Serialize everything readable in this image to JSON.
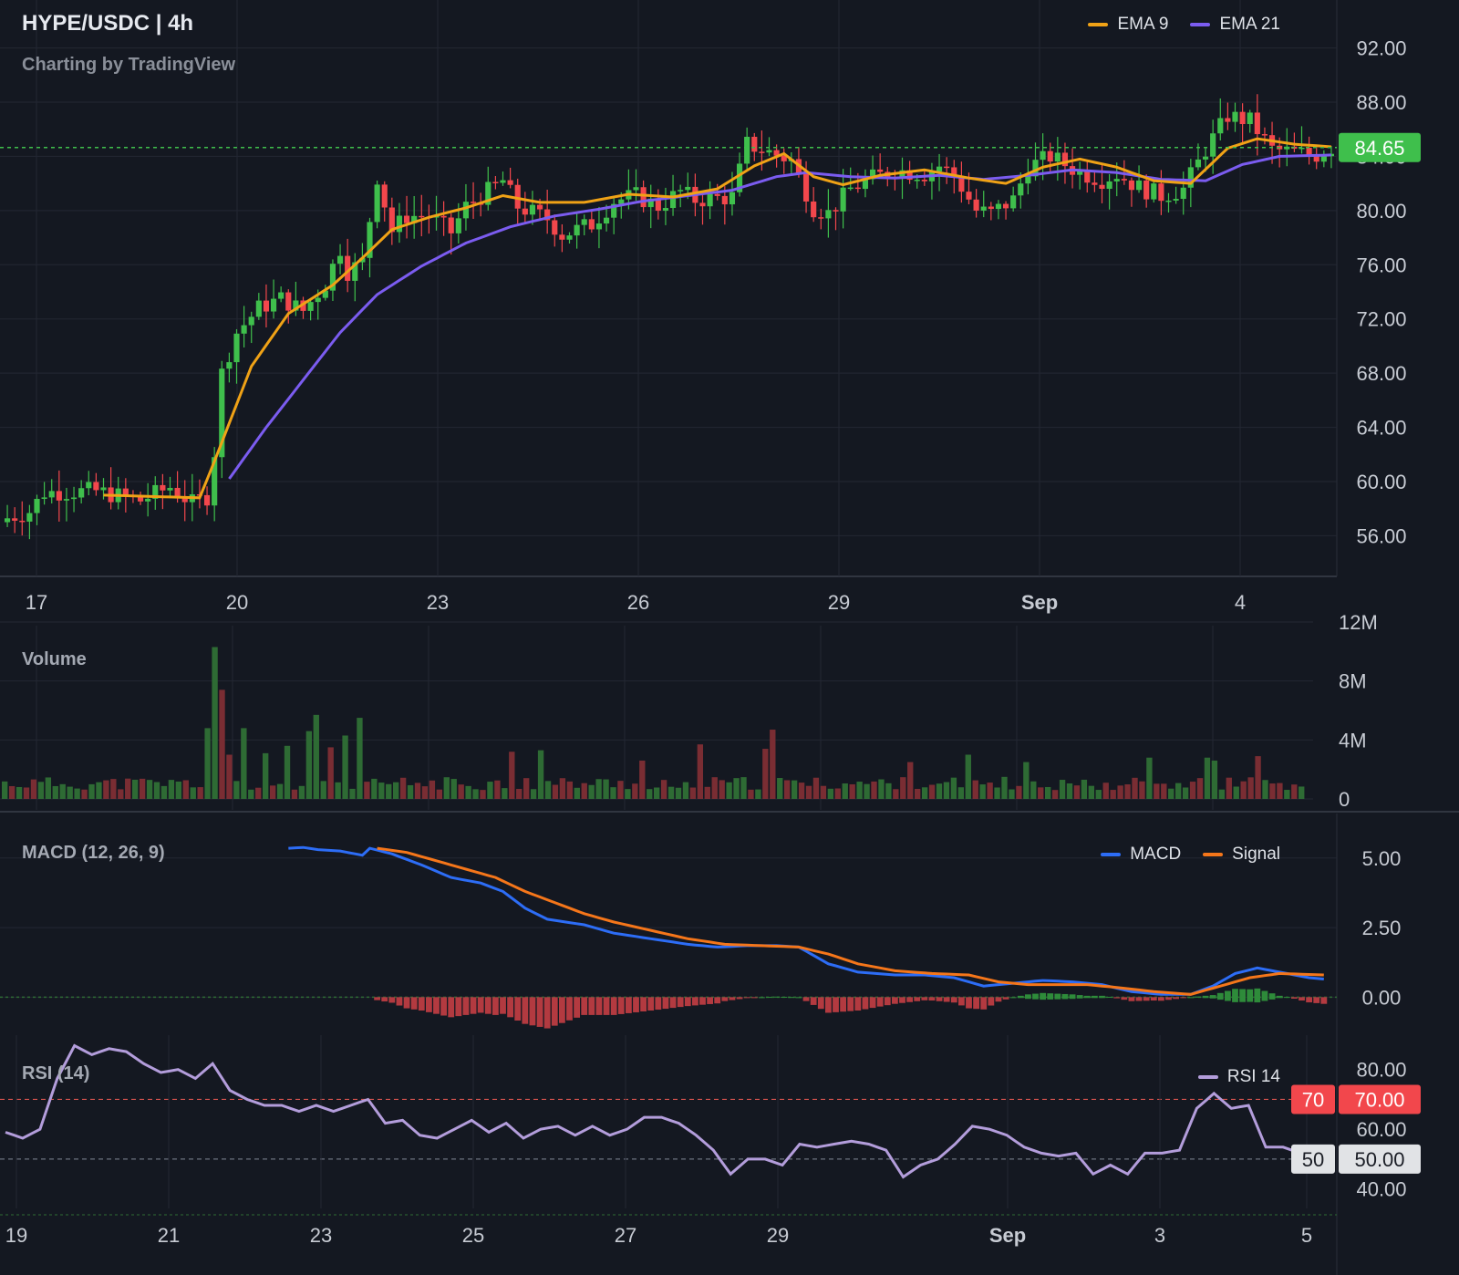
{
  "header": {
    "symbol_title": "HYPE/USDC | 4h",
    "watermark": "Charting by TradingView"
  },
  "price_pane": {
    "legend": [
      {
        "label": "EMA 9",
        "color": "#f0a216"
      },
      {
        "label": "EMA 21",
        "color": "#7b5cf0"
      }
    ],
    "last_price_label": "84.65",
    "y_ticks": [
      "92.00",
      "88.00",
      "84.00",
      "80.00",
      "76.00",
      "72.00",
      "68.00",
      "64.00",
      "60.00",
      "56.00"
    ],
    "x_ticks": [
      "17",
      "20",
      "23",
      "26",
      "29",
      "Sep",
      "4"
    ]
  },
  "volume_pane": {
    "title": "Volume",
    "y_ticks": [
      "12M",
      "8M",
      "4M",
      "0"
    ]
  },
  "macd_pane": {
    "title": "MACD (12, 26, 9)",
    "legend": [
      {
        "label": "MACD",
        "color": "#2d6df6"
      },
      {
        "label": "Signal",
        "color": "#f5761a"
      }
    ],
    "y_ticks": [
      "5.00",
      "2.50",
      "0.00"
    ]
  },
  "rsi_pane": {
    "title": "RSI (14)",
    "legend": [
      {
        "label": "RSI 14",
        "color": "#b39ddb"
      }
    ],
    "y_ticks": [
      "80.00",
      "60.00",
      "40.00"
    ],
    "badges": {
      "upper_level": "70",
      "upper_value": "70.00",
      "mid_level": "50",
      "mid_value": "50.00"
    },
    "x_ticks": [
      "19",
      "21",
      "23",
      "25",
      "27",
      "29",
      "Sep",
      "3",
      "5"
    ]
  },
  "chart_data": [
    {
      "type": "candlestick",
      "title": "HYPE/USDC | 4h",
      "ylim": [
        53,
        95
      ],
      "last_price": 84.65,
      "colors": {
        "up": "#3fbf4c",
        "down": "#f2474c"
      },
      "anchors": [
        [
          0,
          57.3
        ],
        [
          3,
          57.8
        ],
        [
          5,
          59.2
        ],
        [
          12,
          59.3
        ],
        [
          18,
          58.6
        ],
        [
          22,
          59.6
        ],
        [
          25,
          58.4
        ],
        [
          27,
          58.9
        ],
        [
          28,
          62.2
        ],
        [
          29,
          68.0
        ],
        [
          31,
          71.0
        ],
        [
          34,
          72.8
        ],
        [
          37,
          73.5
        ],
        [
          40,
          72.6
        ],
        [
          43,
          74.6
        ],
        [
          45,
          77.2
        ],
        [
          46,
          75.5
        ],
        [
          48,
          76.2
        ],
        [
          50,
          82.5
        ],
        [
          52,
          78.5
        ],
        [
          54,
          79.6
        ],
        [
          57,
          79.6
        ],
        [
          60,
          78.4
        ],
        [
          62,
          80.3
        ],
        [
          66,
          81.8
        ],
        [
          67,
          82.2
        ],
        [
          69,
          80.3
        ],
        [
          73,
          79.4
        ],
        [
          75,
          78.2
        ],
        [
          79,
          79.0
        ],
        [
          82,
          80.7
        ],
        [
          85,
          81.1
        ],
        [
          88,
          80.3
        ],
        [
          91,
          81.4
        ],
        [
          93,
          80.8
        ],
        [
          98,
          81.0
        ],
        [
          100,
          84.9
        ],
        [
          103,
          84.3
        ],
        [
          106,
          83.7
        ],
        [
          109,
          80.2
        ],
        [
          111,
          79.8
        ],
        [
          114,
          81.6
        ],
        [
          117,
          82.4
        ],
        [
          120,
          83.0
        ],
        [
          124,
          82.7
        ],
        [
          126,
          83.3
        ],
        [
          128,
          82.6
        ],
        [
          131,
          80.0
        ],
        [
          133,
          79.8
        ],
        [
          136,
          80.8
        ],
        [
          138,
          83.2
        ],
        [
          141,
          84.0
        ],
        [
          145,
          82.8
        ],
        [
          148,
          82.3
        ],
        [
          150,
          82.7
        ],
        [
          153,
          81.7
        ],
        [
          156,
          81.1
        ],
        [
          159,
          81.6
        ],
        [
          162,
          84.5
        ],
        [
          165,
          87.0
        ],
        [
          168,
          86.6
        ],
        [
          171,
          84.5
        ],
        [
          174,
          84.3
        ],
        [
          177,
          84.1
        ],
        [
          179,
          84.65
        ]
      ],
      "ema9_anchors": [
        [
          13,
          59.0
        ],
        [
          26,
          58.8
        ],
        [
          28,
          61.5
        ],
        [
          33,
          68.5
        ],
        [
          38,
          72.4
        ],
        [
          44,
          74.5
        ],
        [
          48,
          76.5
        ],
        [
          52,
          78.6
        ],
        [
          57,
          79.5
        ],
        [
          62,
          80.2
        ],
        [
          67,
          81.1
        ],
        [
          72,
          80.6
        ],
        [
          78,
          80.6
        ],
        [
          84,
          81.2
        ],
        [
          90,
          81.0
        ],
        [
          96,
          81.6
        ],
        [
          101,
          83.3
        ],
        [
          105,
          84.2
        ],
        [
          109,
          82.5
        ],
        [
          113,
          81.9
        ],
        [
          118,
          82.6
        ],
        [
          124,
          83.0
        ],
        [
          130,
          82.4
        ],
        [
          135,
          82.0
        ],
        [
          140,
          83.2
        ],
        [
          145,
          83.8
        ],
        [
          150,
          83.2
        ],
        [
          155,
          82.2
        ],
        [
          160,
          82.0
        ],
        [
          165,
          84.6
        ],
        [
          169,
          85.3
        ],
        [
          174,
          84.9
        ],
        [
          179,
          84.7
        ]
      ],
      "ema21_anchors": [
        [
          30,
          60.2
        ],
        [
          35,
          64.0
        ],
        [
          40,
          67.5
        ],
        [
          45,
          71.0
        ],
        [
          50,
          73.8
        ],
        [
          56,
          75.9
        ],
        [
          62,
          77.6
        ],
        [
          68,
          78.8
        ],
        [
          74,
          79.6
        ],
        [
          80,
          80.1
        ],
        [
          86,
          80.7
        ],
        [
          92,
          81.1
        ],
        [
          98,
          81.5
        ],
        [
          104,
          82.5
        ],
        [
          108,
          82.8
        ],
        [
          114,
          82.5
        ],
        [
          120,
          82.4
        ],
        [
          126,
          82.6
        ],
        [
          132,
          82.3
        ],
        [
          138,
          82.6
        ],
        [
          144,
          83.0
        ],
        [
          150,
          82.8
        ],
        [
          156,
          82.3
        ],
        [
          162,
          82.2
        ],
        [
          167,
          83.4
        ],
        [
          172,
          84.0
        ],
        [
          179,
          84.1
        ]
      ],
      "x_ticks": [
        "17",
        "20",
        "23",
        "26",
        "29",
        "Sep",
        "4"
      ]
    },
    {
      "type": "bar",
      "title": "Volume",
      "ylim": [
        0,
        12
      ],
      "units": "M",
      "spikes": {
        "28": 4.8,
        "29": 10.3,
        "30": 7.4,
        "31": 3.0,
        "33": 4.8,
        "36": 3.1,
        "39": 3.6,
        "42": 4.6,
        "43": 5.7,
        "45": 3.5,
        "47": 4.3,
        "49": 5.5,
        "70": 3.2,
        "74": 3.3,
        "88": 2.6,
        "96": 3.7,
        "105": 3.4,
        "106": 4.7,
        "125": 2.5,
        "133": 3.0,
        "141": 2.5,
        "158": 2.8,
        "166": 2.8,
        "167": 2.6,
        "173": 2.9
      },
      "base": 0.6,
      "y_ticks": [
        "12M",
        "8M",
        "4M",
        "0"
      ]
    },
    {
      "type": "line",
      "title": "MACD (12, 26, 9)",
      "ylim": [
        -1.2,
        6.5
      ],
      "macd_anchors": [
        [
          38,
          5.35
        ],
        [
          40,
          5.38
        ],
        [
          42,
          5.3
        ],
        [
          45,
          5.25
        ],
        [
          48,
          5.1
        ],
        [
          49,
          5.35
        ],
        [
          52,
          5.15
        ],
        [
          56,
          4.75
        ],
        [
          60,
          4.3
        ],
        [
          64,
          4.1
        ],
        [
          67,
          3.8
        ],
        [
          70,
          3.2
        ],
        [
          73,
          2.8
        ],
        [
          78,
          2.6
        ],
        [
          82,
          2.3
        ],
        [
          87,
          2.1
        ],
        [
          92,
          1.9
        ],
        [
          96,
          1.8
        ],
        [
          100,
          1.85
        ],
        [
          104,
          1.85
        ],
        [
          107,
          1.8
        ],
        [
          111,
          1.2
        ],
        [
          115,
          0.9
        ],
        [
          120,
          0.8
        ],
        [
          124,
          0.8
        ],
        [
          128,
          0.7
        ],
        [
          132,
          0.4
        ],
        [
          136,
          0.5
        ],
        [
          140,
          0.6
        ],
        [
          144,
          0.55
        ],
        [
          148,
          0.45
        ],
        [
          152,
          0.2
        ],
        [
          156,
          0.1
        ],
        [
          160,
          0.1
        ],
        [
          163,
          0.4
        ],
        [
          166,
          0.85
        ],
        [
          169,
          1.05
        ],
        [
          172,
          0.9
        ],
        [
          176,
          0.7
        ],
        [
          178,
          0.65
        ]
      ],
      "signal_anchors": [
        [
          50,
          5.35
        ],
        [
          54,
          5.2
        ],
        [
          58,
          4.9
        ],
        [
          62,
          4.6
        ],
        [
          66,
          4.3
        ],
        [
          70,
          3.8
        ],
        [
          74,
          3.4
        ],
        [
          78,
          3.0
        ],
        [
          82,
          2.7
        ],
        [
          87,
          2.4
        ],
        [
          92,
          2.1
        ],
        [
          97,
          1.9
        ],
        [
          102,
          1.85
        ],
        [
          107,
          1.8
        ],
        [
          111,
          1.55
        ],
        [
          115,
          1.2
        ],
        [
          120,
          0.95
        ],
        [
          125,
          0.85
        ],
        [
          130,
          0.8
        ],
        [
          134,
          0.55
        ],
        [
          138,
          0.45
        ],
        [
          142,
          0.45
        ],
        [
          146,
          0.45
        ],
        [
          150,
          0.35
        ],
        [
          155,
          0.2
        ],
        [
          160,
          0.1
        ],
        [
          164,
          0.4
        ],
        [
          168,
          0.7
        ],
        [
          172,
          0.85
        ],
        [
          178,
          0.8
        ]
      ],
      "histogram_note": "MACD minus Signal",
      "y_ticks": [
        "5.00",
        "2.50",
        "0.00"
      ]
    },
    {
      "type": "line",
      "title": "RSI (14)",
      "ylim": [
        35,
        90
      ],
      "levels": [
        70,
        50
      ],
      "rsi_anchors": [
        [
          0,
          59
        ],
        [
          2,
          57
        ],
        [
          4,
          60
        ],
        [
          6,
          77
        ],
        [
          8,
          88
        ],
        [
          10,
          85
        ],
        [
          12,
          87
        ],
        [
          14,
          86
        ],
        [
          16,
          82
        ],
        [
          18,
          79
        ],
        [
          20,
          80
        ],
        [
          22,
          77
        ],
        [
          24,
          82
        ],
        [
          26,
          73
        ],
        [
          28,
          70
        ],
        [
          30,
          68
        ],
        [
          32,
          68
        ],
        [
          34,
          66
        ],
        [
          36,
          68
        ],
        [
          38,
          66
        ],
        [
          40,
          68
        ],
        [
          42,
          70
        ],
        [
          44,
          62
        ],
        [
          46,
          63
        ],
        [
          48,
          58
        ],
        [
          50,
          57
        ],
        [
          52,
          60
        ],
        [
          54,
          63
        ],
        [
          56,
          59
        ],
        [
          58,
          62
        ],
        [
          60,
          57
        ],
        [
          62,
          60
        ],
        [
          64,
          61
        ],
        [
          66,
          58
        ],
        [
          68,
          61
        ],
        [
          70,
          58
        ],
        [
          72,
          60
        ],
        [
          74,
          64
        ],
        [
          76,
          64
        ],
        [
          78,
          62
        ],
        [
          80,
          58
        ],
        [
          82,
          53
        ],
        [
          84,
          45
        ],
        [
          86,
          50
        ],
        [
          88,
          50
        ],
        [
          90,
          48
        ],
        [
          92,
          55
        ],
        [
          94,
          54
        ],
        [
          96,
          55
        ],
        [
          98,
          56
        ],
        [
          100,
          55
        ],
        [
          102,
          53
        ],
        [
          104,
          44
        ],
        [
          106,
          48
        ],
        [
          108,
          50
        ],
        [
          110,
          55
        ],
        [
          112,
          61
        ],
        [
          114,
          60
        ],
        [
          116,
          58
        ],
        [
          118,
          54
        ],
        [
          120,
          52
        ],
        [
          122,
          51
        ],
        [
          124,
          52
        ],
        [
          126,
          45
        ],
        [
          128,
          48
        ],
        [
          130,
          45
        ],
        [
          132,
          52
        ],
        [
          134,
          52
        ],
        [
          136,
          53
        ],
        [
          138,
          67
        ],
        [
          140,
          72
        ],
        [
          142,
          67
        ],
        [
          144,
          68
        ],
        [
          146,
          54
        ],
        [
          148,
          54
        ],
        [
          150,
          52
        ]
      ],
      "x_ticks": [
        "19",
        "21",
        "23",
        "25",
        "27",
        "29",
        "Sep",
        "3",
        "5"
      ]
    }
  ]
}
